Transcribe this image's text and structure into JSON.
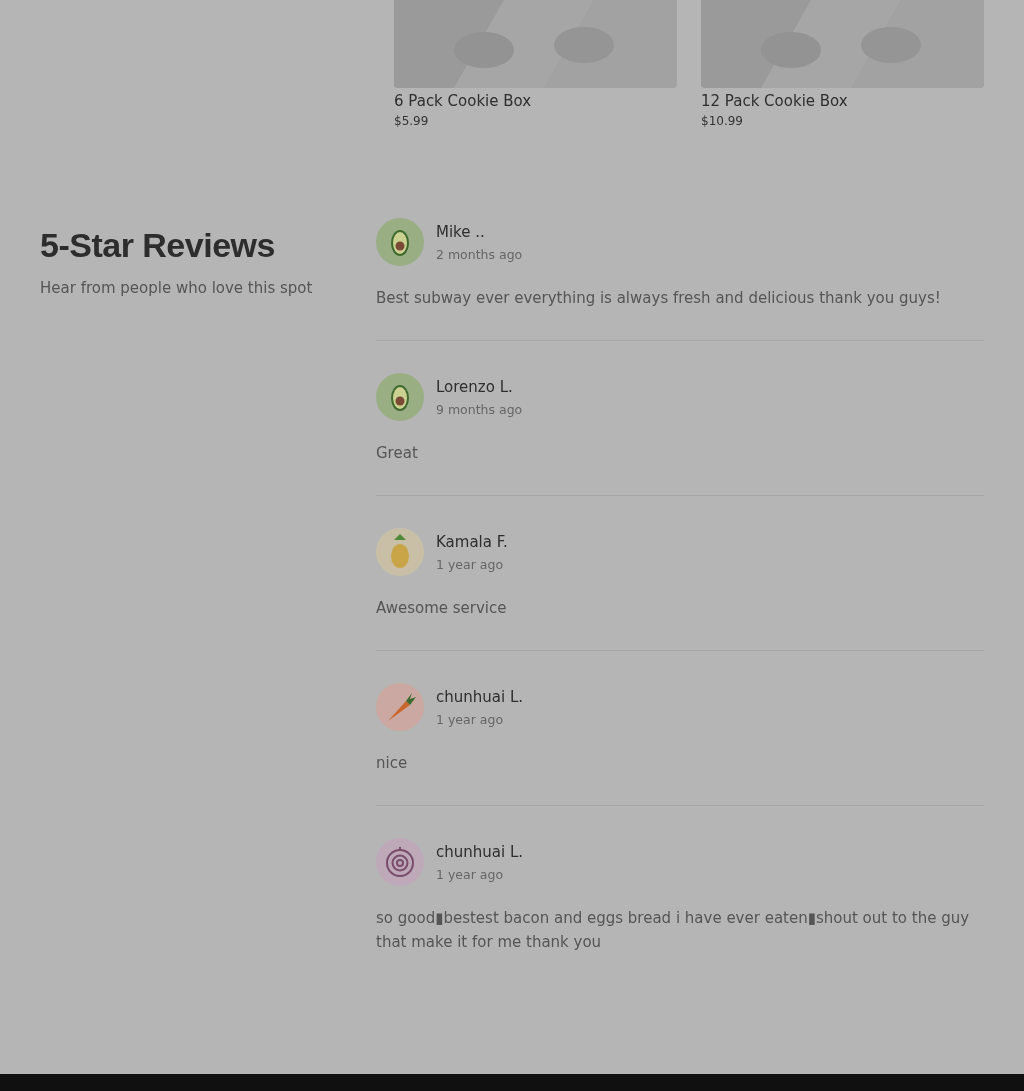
{
  "products": [
    {
      "name": "6 Pack Cookie Box",
      "price": "$5.99"
    },
    {
      "name": "12 Pack Cookie Box",
      "price": "$10.99"
    }
  ],
  "reviews_section": {
    "title": "5-Star Reviews",
    "subtitle": "Hear from people who love this spot"
  },
  "reviews": [
    {
      "name": "Mike ..",
      "time": "2 months ago",
      "text": "Best subway ever everything is always fresh and delicious thank you guys!",
      "avatar": {
        "kind": "avocado"
      }
    },
    {
      "name": "Lorenzo L.",
      "time": "9 months ago",
      "text": "Great",
      "avatar": {
        "kind": "avocado"
      }
    },
    {
      "name": "Kamala F.",
      "time": "1 year ago",
      "text": "Awesome service",
      "avatar": {
        "kind": "pineapple"
      }
    },
    {
      "name": "chunhuai L.",
      "time": "1 year ago",
      "text": "nice",
      "avatar": {
        "kind": "carrot"
      }
    },
    {
      "name": "chunhuai L.",
      "time": "1 year ago",
      "text": "so good▮bestest bacon and eggs bread i have ever eaten▮shout out to the guy that make it for me thank you",
      "avatar": {
        "kind": "onion"
      }
    }
  ]
}
